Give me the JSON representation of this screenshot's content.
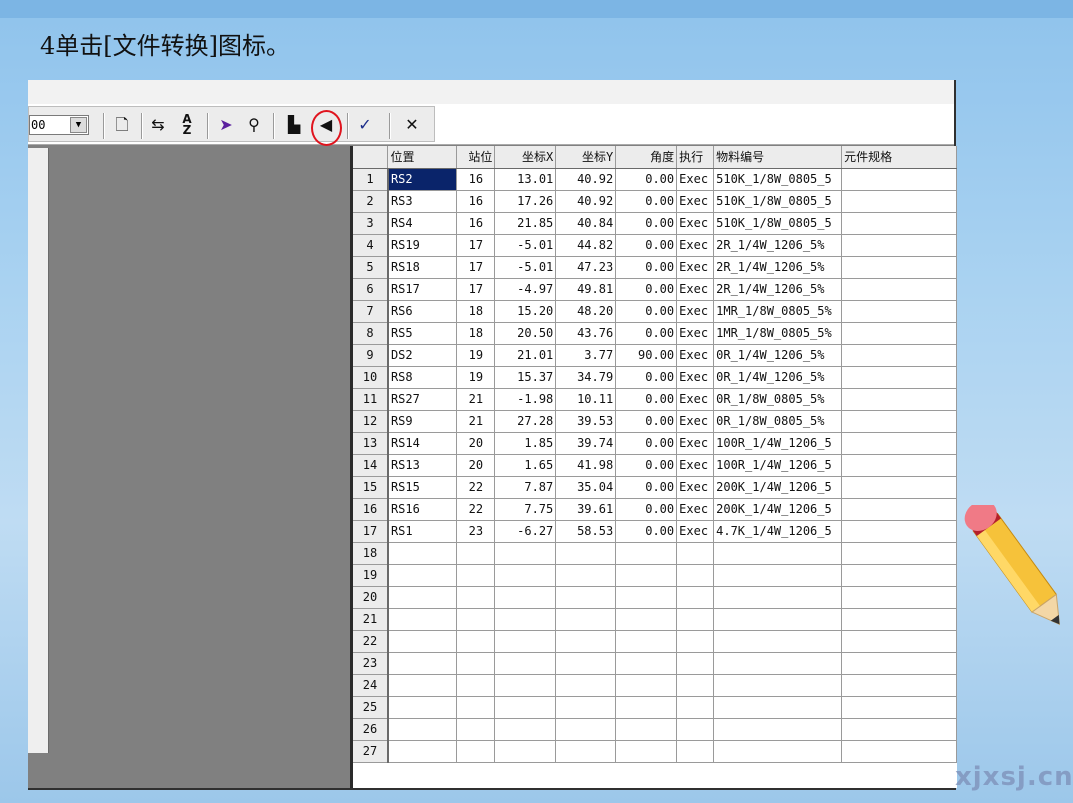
{
  "slide": {
    "title": "4单击[文件转换]图标。"
  },
  "toolbar": {
    "zoom_value": "00",
    "highlighted_tool": "文件转换",
    "icons": [
      "new-file-icon",
      "swap-icon",
      "sort-az-icon",
      "pointer-icon",
      "binoculars-icon",
      "save-icon",
      "convert-file-icon",
      "spellcheck-icon",
      "close-icon"
    ]
  },
  "grid": {
    "columns": [
      "",
      "位置",
      "站位",
      "坐标X",
      "坐标Y",
      "角度",
      "执行",
      "物料编号",
      "元件规格"
    ],
    "rows": [
      [
        "1",
        "RS2",
        "16",
        "13.01",
        "40.92",
        "0.00",
        "Exec",
        "510K_1/8W_0805_5",
        ""
      ],
      [
        "2",
        "RS3",
        "16",
        "17.26",
        "40.92",
        "0.00",
        "Exec",
        "510K_1/8W_0805_5",
        ""
      ],
      [
        "3",
        "RS4",
        "16",
        "21.85",
        "40.84",
        "0.00",
        "Exec",
        "510K_1/8W_0805_5",
        ""
      ],
      [
        "4",
        "RS19",
        "17",
        "-5.01",
        "44.82",
        "0.00",
        "Exec",
        "2R_1/4W_1206_5%",
        ""
      ],
      [
        "5",
        "RS18",
        "17",
        "-5.01",
        "47.23",
        "0.00",
        "Exec",
        "2R_1/4W_1206_5%",
        ""
      ],
      [
        "6",
        "RS17",
        "17",
        "-4.97",
        "49.81",
        "0.00",
        "Exec",
        "2R_1/4W_1206_5%",
        ""
      ],
      [
        "7",
        "RS6",
        "18",
        "15.20",
        "48.20",
        "0.00",
        "Exec",
        "1MR_1/8W_0805_5%",
        ""
      ],
      [
        "8",
        "RS5",
        "18",
        "20.50",
        "43.76",
        "0.00",
        "Exec",
        "1MR_1/8W_0805_5%",
        ""
      ],
      [
        "9",
        "DS2",
        "19",
        "21.01",
        "3.77",
        "90.00",
        "Exec",
        "0R_1/4W_1206_5%",
        ""
      ],
      [
        "10",
        "RS8",
        "19",
        "15.37",
        "34.79",
        "0.00",
        "Exec",
        "0R_1/4W_1206_5%",
        ""
      ],
      [
        "11",
        "RS27",
        "21",
        "-1.98",
        "10.11",
        "0.00",
        "Exec",
        "0R_1/8W_0805_5%",
        ""
      ],
      [
        "12",
        "RS9",
        "21",
        "27.28",
        "39.53",
        "0.00",
        "Exec",
        "0R_1/8W_0805_5%",
        ""
      ],
      [
        "13",
        "RS14",
        "20",
        "1.85",
        "39.74",
        "0.00",
        "Exec",
        "100R_1/4W_1206_5",
        ""
      ],
      [
        "14",
        "RS13",
        "20",
        "1.65",
        "41.98",
        "0.00",
        "Exec",
        "100R_1/4W_1206_5",
        ""
      ],
      [
        "15",
        "RS15",
        "22",
        "7.87",
        "35.04",
        "0.00",
        "Exec",
        "200K_1/4W_1206_5",
        ""
      ],
      [
        "16",
        "RS16",
        "22",
        "7.75",
        "39.61",
        "0.00",
        "Exec",
        "200K_1/4W_1206_5",
        ""
      ],
      [
        "17",
        "RS1",
        "23",
        "-6.27",
        "58.53",
        "0.00",
        "Exec",
        "4.7K_1/4W_1206_5",
        ""
      ],
      [
        "18",
        "",
        "",
        "",
        "",
        "",
        "",
        "",
        ""
      ],
      [
        "19",
        "",
        "",
        "",
        "",
        "",
        "",
        "",
        ""
      ],
      [
        "20",
        "",
        "",
        "",
        "",
        "",
        "",
        "",
        ""
      ],
      [
        "21",
        "",
        "",
        "",
        "",
        "",
        "",
        "",
        ""
      ],
      [
        "22",
        "",
        "",
        "",
        "",
        "",
        "",
        "",
        ""
      ],
      [
        "23",
        "",
        "",
        "",
        "",
        "",
        "",
        "",
        ""
      ],
      [
        "24",
        "",
        "",
        "",
        "",
        "",
        "",
        "",
        ""
      ],
      [
        "25",
        "",
        "",
        "",
        "",
        "",
        "",
        "",
        ""
      ],
      [
        "26",
        "",
        "",
        "",
        "",
        "",
        "",
        "",
        ""
      ],
      [
        "27",
        "",
        "",
        "",
        "",
        "",
        "",
        "",
        ""
      ]
    ],
    "selected_cell": "RS2"
  },
  "watermark": "xjxsj.cn",
  "colors": {
    "highlight_ring": "#e0141e",
    "selection": "#0a246a",
    "slide_background": "#a9d2f1"
  }
}
